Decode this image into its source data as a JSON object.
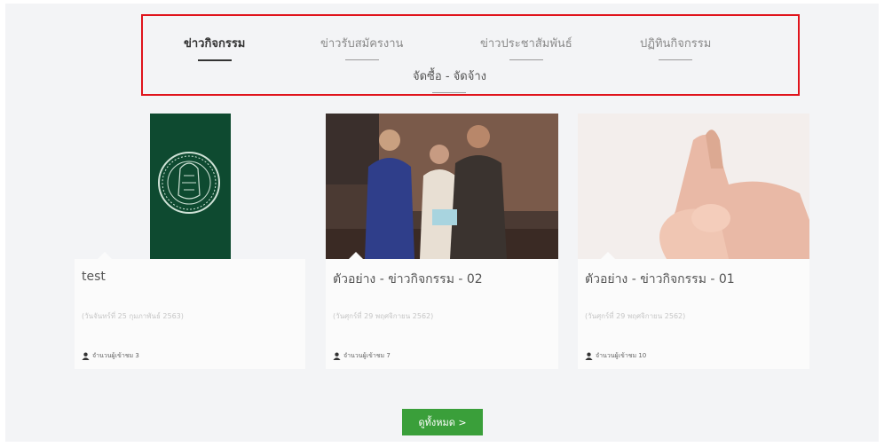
{
  "tabs": [
    {
      "label": "ข่าวกิจกรรม",
      "active": true
    },
    {
      "label": "ข่าวรับสมัครงาน",
      "active": false
    },
    {
      "label": "ข่าวประชาสัมพันธ์",
      "active": false
    },
    {
      "label": "ปฏิทินกิจกรรม",
      "active": false
    },
    {
      "label": "จัดซื้อ - จัดจ้าง",
      "active": false
    }
  ],
  "cards": [
    {
      "title": "test",
      "date": "(วันจันทร์ที่ 25 กุมภาพันธ์ 2563)",
      "views": "จำนวนผู้เข้าชม 3"
    },
    {
      "title": "ตัวอย่าง - ข่าวกิจกรรม - 02",
      "date": "(วันศุกร์ที่ 29 พฤศจิกายน 2562)",
      "views": "จำนวนผู้เข้าชม 7"
    },
    {
      "title": "ตัวอย่าง - ข่าวกิจกรรม - 01",
      "date": "(วันศุกร์ที่ 29 พฤศจิกายน 2562)",
      "views": "จำนวนผู้เข้าชม 10"
    }
  ],
  "view_all_label": "ดูทั้งหมด >",
  "colors": {
    "accent_green": "#3a9f3a",
    "highlight_red": "#e0141c",
    "seal_green": "#0e4a30"
  }
}
